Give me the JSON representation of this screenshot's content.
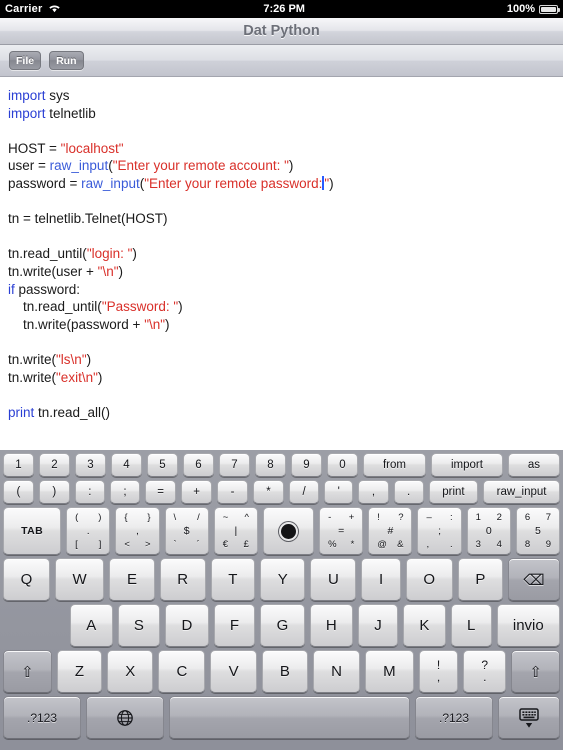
{
  "status_bar": {
    "carrier": "Carrier",
    "wifi_icon": "wifi-icon",
    "time": "7:26 PM",
    "battery_percent": "100%",
    "battery_icon": "battery-full-icon"
  },
  "navbar": {
    "title": "Dat Python"
  },
  "toolbar": {
    "file_label": "File",
    "run_label": "Run"
  },
  "editor": {
    "language": "python",
    "caret_line": 6,
    "caret_after": "Enter your remote password:",
    "colors": {
      "keyword": "#2a3fd4",
      "function": "#3a5bd9",
      "string": "#d9302a",
      "text": "#1a1a1a",
      "caret": "#2a5bff"
    },
    "lines": [
      {
        "parts": [
          {
            "t": "import ",
            "c": "kw"
          },
          {
            "t": "sys",
            "c": "txt"
          }
        ]
      },
      {
        "parts": [
          {
            "t": "import ",
            "c": "kw"
          },
          {
            "t": "telnetlib",
            "c": "txt"
          }
        ]
      },
      {
        "parts": []
      },
      {
        "parts": [
          {
            "t": "HOST = ",
            "c": "txt"
          },
          {
            "t": "\"localhost\"",
            "c": "str"
          }
        ]
      },
      {
        "parts": [
          {
            "t": "user = ",
            "c": "txt"
          },
          {
            "t": "raw_input",
            "c": "fn"
          },
          {
            "t": "(",
            "c": "txt"
          },
          {
            "t": "\"Enter your remote account: \"",
            "c": "str"
          },
          {
            "t": ")",
            "c": "txt"
          }
        ]
      },
      {
        "parts": [
          {
            "t": "password = ",
            "c": "txt"
          },
          {
            "t": "raw_input",
            "c": "fn"
          },
          {
            "t": "(",
            "c": "txt"
          },
          {
            "t": "\"Enter your remote password:",
            "c": "str"
          },
          {
            "t": "|CARET|",
            "c": "caret"
          },
          {
            "t": "\"",
            "c": "str"
          },
          {
            "t": ")",
            "c": "txt"
          }
        ]
      },
      {
        "parts": []
      },
      {
        "parts": [
          {
            "t": "tn = telnetlib.Telnet(HOST)",
            "c": "txt"
          }
        ]
      },
      {
        "parts": []
      },
      {
        "parts": [
          {
            "t": "tn.read_until(",
            "c": "txt"
          },
          {
            "t": "\"login: \"",
            "c": "str"
          },
          {
            "t": ")",
            "c": "txt"
          }
        ]
      },
      {
        "parts": [
          {
            "t": "tn.write(user + ",
            "c": "txt"
          },
          {
            "t": "\"\\n\"",
            "c": "str"
          },
          {
            "t": ")",
            "c": "txt"
          }
        ]
      },
      {
        "parts": [
          {
            "t": "if",
            "c": "kw"
          },
          {
            "t": " password:",
            "c": "txt"
          }
        ]
      },
      {
        "parts": [
          {
            "t": "    tn.read_until(",
            "c": "txt"
          },
          {
            "t": "\"Password: \"",
            "c": "str"
          },
          {
            "t": ")",
            "c": "txt"
          }
        ]
      },
      {
        "parts": [
          {
            "t": "    tn.write(password + ",
            "c": "txt"
          },
          {
            "t": "\"\\n\"",
            "c": "str"
          },
          {
            "t": ")",
            "c": "txt"
          }
        ]
      },
      {
        "parts": []
      },
      {
        "parts": [
          {
            "t": "tn.write(",
            "c": "txt"
          },
          {
            "t": "\"ls\\n\"",
            "c": "str"
          },
          {
            "t": ")",
            "c": "txt"
          }
        ]
      },
      {
        "parts": [
          {
            "t": "tn.write(",
            "c": "txt"
          },
          {
            "t": "\"exit\\n\"",
            "c": "str"
          },
          {
            "t": ")",
            "c": "txt"
          }
        ]
      },
      {
        "parts": []
      },
      {
        "parts": [
          {
            "t": "print",
            "c": "kw"
          },
          {
            "t": " tn.read_all()",
            "c": "txt"
          }
        ]
      }
    ]
  },
  "keyboard": {
    "layout": "italian-ipad-with-python-accessory",
    "accessory_row_1": [
      "1",
      "2",
      "3",
      "4",
      "5",
      "6",
      "7",
      "8",
      "9",
      "0"
    ],
    "accessory_row_1_words": [
      "from",
      "import",
      "as"
    ],
    "accessory_row_2": [
      "(",
      ")",
      ":",
      ";",
      "=",
      "+",
      "-",
      "*",
      "/",
      "'",
      ",",
      "."
    ],
    "accessory_row_2_words": [
      "print",
      "raw_input"
    ],
    "symbol_row": [
      {
        "name": "tab",
        "label": "TAB"
      },
      {
        "name": "brace-dot",
        "tl": "(",
        "tr": ")",
        "bl": "[",
        "br": "]",
        "center": "."
      },
      {
        "name": "angle-comma",
        "tl": "{",
        "tr": "}",
        "bl": "<",
        "br": ">",
        "center": ","
      },
      {
        "name": "slash-dollar",
        "tl": "\\",
        "tr": "/",
        "bl": "`",
        "br": "´",
        "center": "$"
      },
      {
        "name": "currency",
        "tl": "~",
        "tr": "^",
        "bl": "€",
        "br": "£",
        "center": "|"
      },
      {
        "name": "record-dot",
        "label": "●"
      },
      {
        "name": "math",
        "tl": "-",
        "tr": "+",
        "bl": "%",
        "br": "*",
        "center": "="
      },
      {
        "name": "punct",
        "tl": "!",
        "tr": "?",
        "bl": "@",
        "br": "&",
        "center": "#"
      },
      {
        "name": "dash-colon",
        "tl": "–",
        "tr": ":",
        "bl": ",",
        "br": ".",
        "center": ";"
      },
      {
        "name": "numpad-low",
        "tl": "1",
        "tr": "2",
        "bl": "3",
        "br": "4",
        "center": "0"
      },
      {
        "name": "numpad-high",
        "tl": "6",
        "tr": "7",
        "bl": "8",
        "br": "9",
        "center": "5"
      }
    ],
    "alpha_row_1": [
      "Q",
      "W",
      "E",
      "R",
      "T",
      "Y",
      "U",
      "I",
      "O",
      "P"
    ],
    "backspace_label": "⌫",
    "alpha_row_2": [
      "A",
      "S",
      "D",
      "F",
      "G",
      "H",
      "J",
      "K",
      "L"
    ],
    "enter_label": "invio",
    "alpha_row_3": [
      "Z",
      "X",
      "C",
      "V",
      "B",
      "N",
      "M"
    ],
    "shift_label": "⇧",
    "excl_key": {
      "up": "!",
      "lo": ","
    },
    "quest_key": {
      "up": "?",
      "lo": "."
    },
    "bottom_row": {
      "numeric_left": ".?123",
      "globe_icon": "globe-icon",
      "space": "",
      "numeric_right": ".?123",
      "hide_keyboard_icon": "hide-keyboard-icon"
    }
  }
}
